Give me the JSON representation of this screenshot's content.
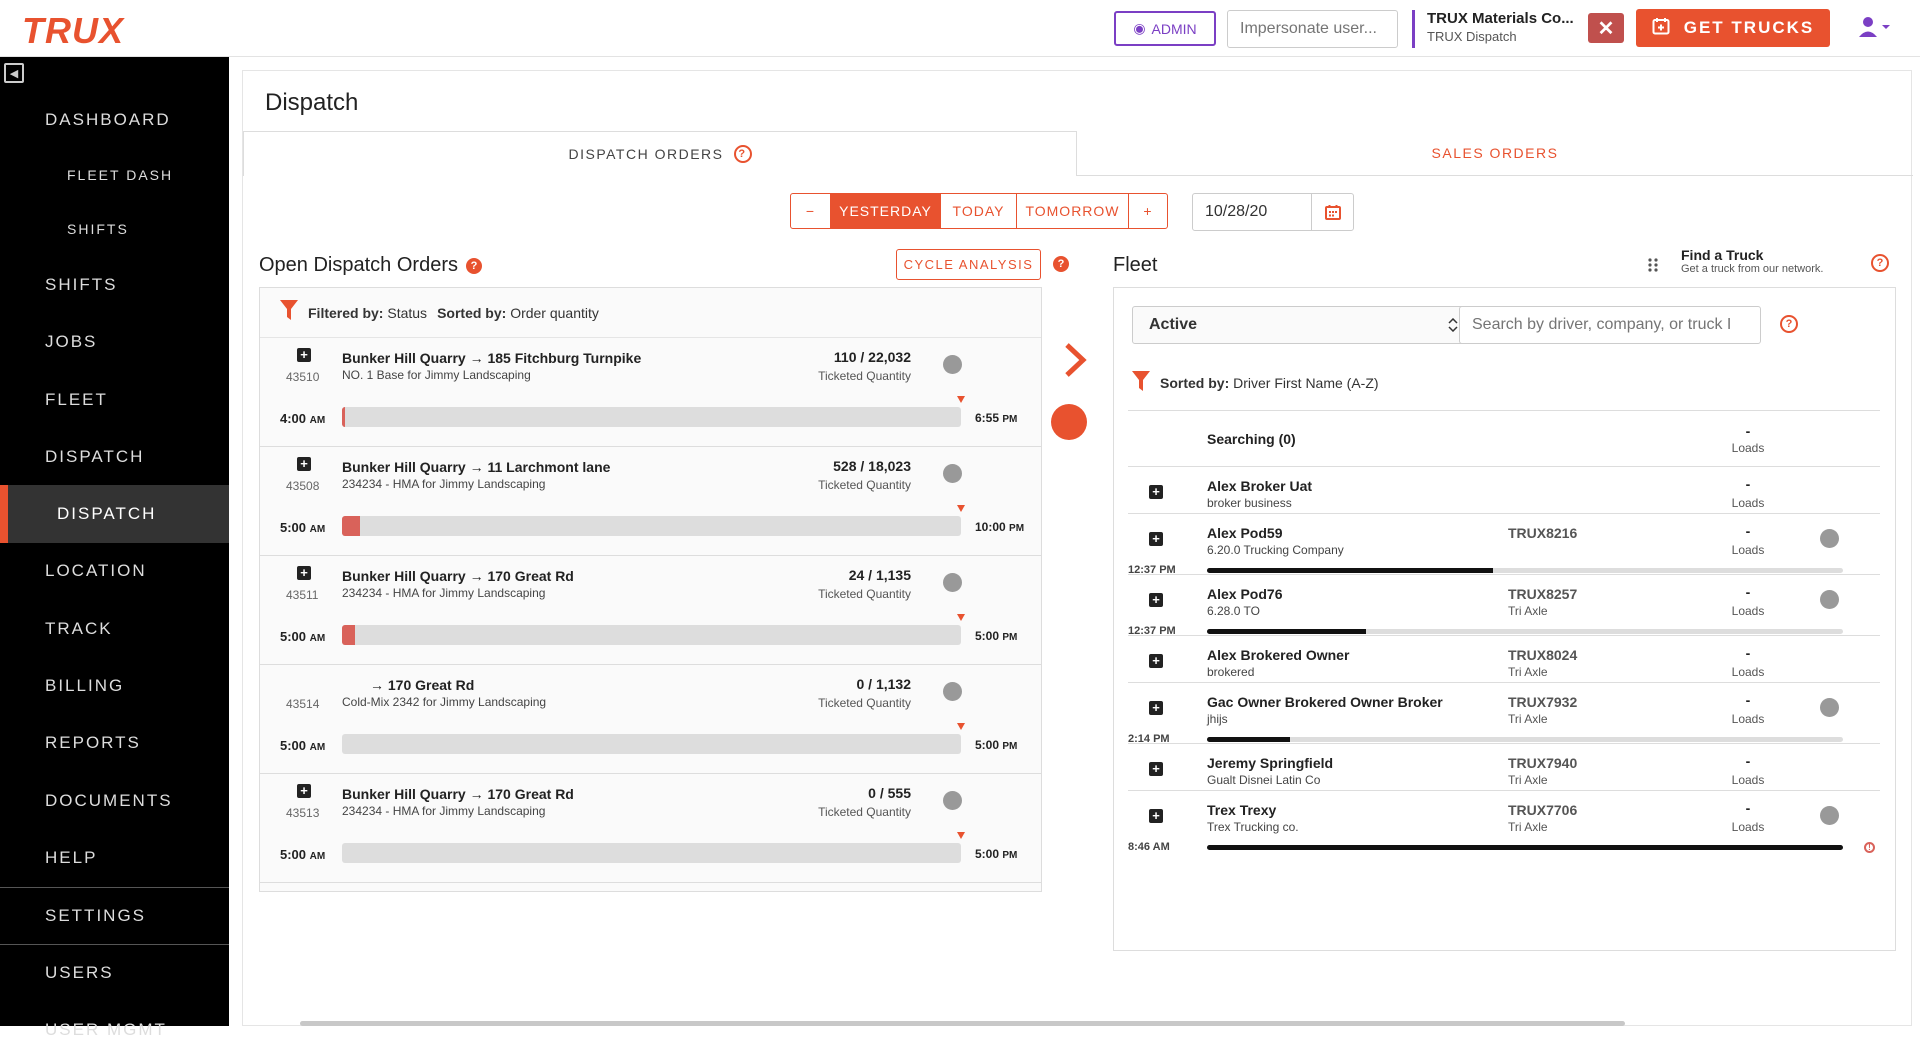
{
  "header": {
    "logo": "TRUX",
    "admin_label": "ADMIN",
    "impersonate_placeholder": "Impersonate user...",
    "company_name": "TRUX Materials Co...",
    "company_sub": "TRUX Dispatch",
    "close_label": "✕",
    "get_trucks_label": "GET TRUCKS"
  },
  "sidebar": {
    "items": [
      {
        "label": "DASHBOARD"
      },
      {
        "label": "FLEET DASH"
      },
      {
        "label": "SHIFTS"
      },
      {
        "label": "SHIFTS"
      },
      {
        "label": "JOBS"
      },
      {
        "label": "FLEET"
      },
      {
        "label": "DISPATCH"
      },
      {
        "label": "DISPATCH"
      },
      {
        "label": "LOCATION"
      },
      {
        "label": "TRACK"
      },
      {
        "label": "BILLING"
      },
      {
        "label": "REPORTS"
      },
      {
        "label": "DOCUMENTS"
      },
      {
        "label": "HELP"
      },
      {
        "label": "SETTINGS"
      },
      {
        "label": "USERS"
      },
      {
        "label": "USER MGMT"
      }
    ]
  },
  "page": {
    "title": "Dispatch",
    "tabs": [
      {
        "label": "DISPATCH ORDERS"
      },
      {
        "label": "SALES ORDERS"
      }
    ],
    "day_buttons": {
      "minus": "−",
      "yesterday": "YESTERDAY",
      "today": "TODAY",
      "tomorrow": "TOMORROW",
      "plus": "+"
    },
    "date_value": "10/28/20"
  },
  "orders_panel": {
    "title": "Open Dispatch Orders",
    "cycle_label": "CYCLE ANALYSIS",
    "filtered_by_label": "Filtered by:",
    "filtered_by_value": "Status",
    "sorted_by_label": "Sorted by:",
    "sorted_by_value": "Order quantity",
    "orders": [
      {
        "id": "43510",
        "from": "Bunker Hill Quarry",
        "arrow": "→",
        "to": "185 Fitchburg Turnpike",
        "desc": "NO. 1 Base for Jimmy Landscaping",
        "qty": "110 / 22,032",
        "qty_label": "Ticketed Quantity",
        "start": "4:00",
        "start_ampm": "AM",
        "end": "6:55",
        "end_ampm": "PM",
        "progress": 0.5
      },
      {
        "id": "43508",
        "from": "Bunker Hill Quarry",
        "arrow": "→",
        "to": "11 Larchmont lane",
        "desc": "234234 - HMA for Jimmy Landscaping",
        "qty": "528 / 18,023",
        "qty_label": "Ticketed Quantity",
        "start": "5:00",
        "start_ampm": "AM",
        "end": "10:00",
        "end_ampm": "PM",
        "progress": 2.9
      },
      {
        "id": "43511",
        "from": "Bunker Hill Quarry",
        "arrow": "→",
        "to": "170 Great Rd",
        "desc": "234234 - HMA for Jimmy Landscaping",
        "qty": "24 / 1,135",
        "qty_label": "Ticketed Quantity",
        "start": "5:00",
        "start_ampm": "AM",
        "end": "5:00",
        "end_ampm": "PM",
        "progress": 2.1
      },
      {
        "id": "43514",
        "from": "",
        "arrow": "→",
        "to": "170 Great Rd",
        "desc": "Cold-Mix 2342 for Jimmy Landscaping",
        "qty": "0 / 1,132",
        "qty_label": "Ticketed Quantity",
        "start": "5:00",
        "start_ampm": "AM",
        "end": "5:00",
        "end_ampm": "PM",
        "progress": 0
      },
      {
        "id": "43513",
        "from": "Bunker Hill Quarry",
        "arrow": "→",
        "to": "170 Great Rd",
        "desc": "234234 - HMA for Jimmy Landscaping",
        "qty": "0 / 555",
        "qty_label": "Ticketed Quantity",
        "start": "5:00",
        "start_ampm": "AM",
        "end": "5:00",
        "end_ampm": "PM",
        "progress": 0
      }
    ]
  },
  "fleet_panel": {
    "title": "Fleet",
    "find_truck_title": "Find a Truck",
    "find_truck_sub": "Get a truck from our network.",
    "status_select": "Active",
    "search_placeholder": "Search by driver, company, or truck I",
    "sorted_by_label": "Sorted by:",
    "sorted_by_value": "Driver First Name (A-Z)",
    "searching_label": "Searching (0)",
    "searching_loads": "-",
    "searching_loads_label": "Loads",
    "drivers": [
      {
        "name": "Alex Broker Uat",
        "company": "broker business",
        "truck": "",
        "truck_type": "",
        "loads": "-",
        "loads_label": "Loads",
        "time": "",
        "progress": null,
        "has_dot": false
      },
      {
        "name": "Alex Pod59",
        "company": "6.20.0 Trucking Company",
        "truck": "TRUX8216",
        "truck_type": "",
        "loads": "-",
        "loads_label": "Loads",
        "time": "12:37 PM",
        "progress": 45,
        "has_dot": true
      },
      {
        "name": "Alex Pod76",
        "company": "6.28.0 TO",
        "truck": "TRUX8257",
        "truck_type": "Tri Axle",
        "loads": "-",
        "loads_label": "Loads",
        "time": "12:37 PM",
        "progress": 25,
        "has_dot": true
      },
      {
        "name": "Alex Brokered Owner",
        "company": "brokered",
        "truck": "TRUX8024",
        "truck_type": "Tri Axle",
        "loads": "-",
        "loads_label": "Loads",
        "time": "",
        "progress": null,
        "has_dot": false
      },
      {
        "name": "Gac Owner Brokered Owner Broker",
        "company": "jhijs",
        "truck": "TRUX7932",
        "truck_type": "Tri Axle",
        "loads": "-",
        "loads_label": "Loads",
        "time": "2:14 PM",
        "progress": 13,
        "has_dot": true
      },
      {
        "name": "Jeremy Springfield",
        "company": "Gualt Disnei Latin Co",
        "truck": "TRUX7940",
        "truck_type": "Tri Axle",
        "loads": "-",
        "loads_label": "Loads",
        "time": "",
        "progress": null,
        "has_dot": false
      },
      {
        "name": "Trex Trexy",
        "company": "Trex Trucking co.",
        "truck": "TRUX7706",
        "truck_type": "Tri Axle",
        "loads": "-",
        "loads_label": "Loads",
        "time": "8:46 AM",
        "progress": 100,
        "has_dot": true
      }
    ]
  },
  "colors": {
    "accent": "#e8522f",
    "admin": "#7b3fc4",
    "bar_fill": "#d9625a"
  }
}
